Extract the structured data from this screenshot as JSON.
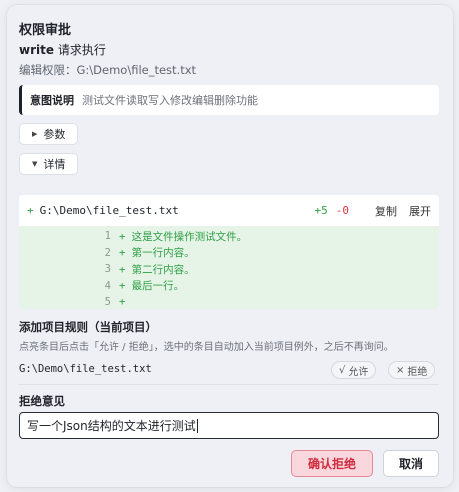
{
  "dialog": {
    "title": "权限审批",
    "request_tool": "write",
    "request_suffix": "请求执行",
    "permission_label": "编辑权限：",
    "permission_path": "G:\\Demo\\file_test.txt"
  },
  "intent": {
    "label": "意图说明",
    "text": "测试文件读取写入修改编辑删除功能"
  },
  "toggles": {
    "params_label": "参数",
    "details_label": "详情"
  },
  "diff": {
    "prefix": "+",
    "file_path": "G:\\Demo\\file_test.txt",
    "additions": "+5",
    "deletions": "-0",
    "copy_label": "复制",
    "expand_label": "展开",
    "lines": [
      {
        "num": "1",
        "text": "+ 这是文件操作测试文件。"
      },
      {
        "num": "2",
        "text": "+ 第一行内容。"
      },
      {
        "num": "3",
        "text": "+ 第二行内容。"
      },
      {
        "num": "4",
        "text": "+ 最后一行。"
      },
      {
        "num": "5",
        "text": "+"
      }
    ]
  },
  "project_rule": {
    "title": "添加项目规则（当前项目）",
    "description": "点亮条目后点击「允许 / 拒绝」，选中的条目自动加入当前项目例外，之后不再询问。",
    "path": "G:\\Demo\\file_test.txt",
    "allow_label": "允许",
    "reject_label": "拒绝"
  },
  "reject_reason": {
    "title": "拒绝意见",
    "value": "写一个Json结构的文本进行测试"
  },
  "actions": {
    "confirm_reject_label": "确认拒绝",
    "cancel_label": "取消"
  }
}
